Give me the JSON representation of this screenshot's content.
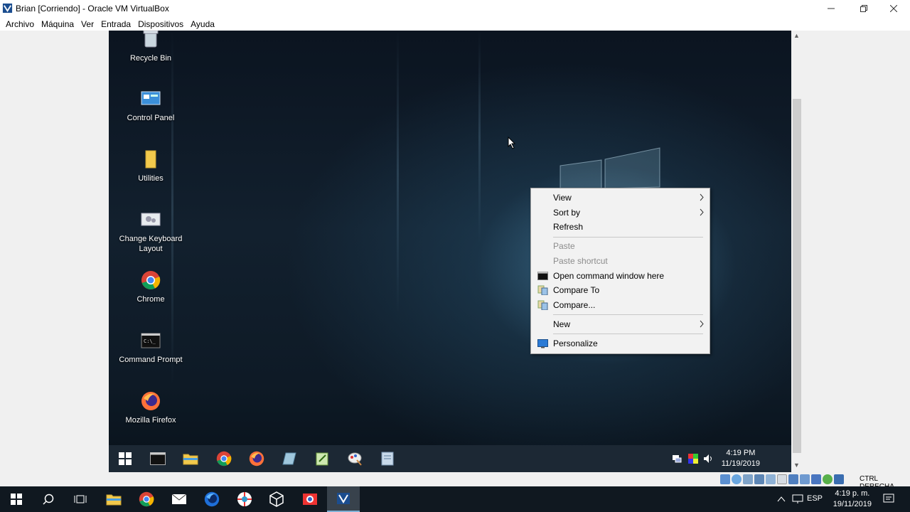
{
  "window": {
    "title": "Brian [Corriendo] - Oracle VM VirtualBox",
    "menu": [
      "Archivo",
      "Máquina",
      "Ver",
      "Entrada",
      "Dispositivos",
      "Ayuda"
    ]
  },
  "desktop": {
    "icons": [
      {
        "label": "Recycle Bin",
        "icon": "recycle-bin-icon"
      },
      {
        "label": "Control Panel",
        "icon": "control-panel-icon"
      },
      {
        "label": "Utilities",
        "icon": "folder-icon"
      },
      {
        "label": "Change Keyboard Layout",
        "icon": "keyboard-settings-icon"
      },
      {
        "label": "Chrome",
        "icon": "chrome-icon"
      },
      {
        "label": "Command Prompt",
        "icon": "command-prompt-icon"
      },
      {
        "label": "Mozilla Firefox",
        "icon": "firefox-icon"
      }
    ]
  },
  "context_menu": {
    "items": [
      {
        "label": "View",
        "submenu": true
      },
      {
        "label": "Sort by",
        "submenu": true
      },
      {
        "label": "Refresh"
      },
      {
        "label": "Paste",
        "disabled": true
      },
      {
        "label": "Paste shortcut",
        "disabled": true
      },
      {
        "label": "Open command window here",
        "icon": "cmd-icon"
      },
      {
        "label": "Compare To",
        "icon": "compare-icon"
      },
      {
        "label": "Compare...",
        "icon": "compare-icon"
      },
      {
        "label": "New",
        "submenu": true
      },
      {
        "label": "Personalize",
        "icon": "personalize-icon"
      }
    ]
  },
  "guest_taskbar": {
    "apps": [
      "start-icon",
      "cmd-icon",
      "file-explorer-icon",
      "chrome-icon",
      "firefox-icon",
      "app-icon",
      "notepad-icon",
      "paint-icon",
      "document-icon"
    ],
    "clock": {
      "time": "4:19 PM",
      "date": "11/19/2019"
    }
  },
  "status_bar": {
    "host_key": "CTRL DERECHA"
  },
  "host_taskbar": {
    "apps": [
      "start-icon",
      "search-icon",
      "task-view-icon",
      "file-explorer-icon",
      "chrome-icon",
      "mail-icon",
      "firefox-icon",
      "app-icon",
      "virtualbox-icon",
      "photo-app-icon",
      "virtualbox-running-icon"
    ],
    "language": "ESP",
    "clock": {
      "time": "4:19 p. m.",
      "date": "19/11/2019"
    }
  },
  "colors": {
    "accent": "#7fb1d6",
    "guest_taskbar": "#1c2834",
    "host_taskbar": "#101820"
  }
}
